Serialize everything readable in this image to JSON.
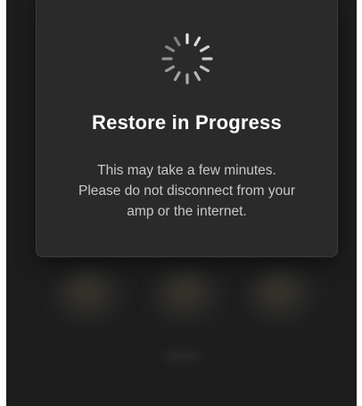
{
  "dialog": {
    "title": "Restore in Progress",
    "message_lines": [
      "This may take a few minutes.",
      "Please do not disconnect from your",
      "amp or the internet."
    ],
    "icon": "loading-spinner-icon"
  },
  "colors": {
    "app_background": "#1d1d1d",
    "dialog_background": "#2a2a2a",
    "title_text": "#ffffff",
    "body_text": "#c8c8c8"
  }
}
